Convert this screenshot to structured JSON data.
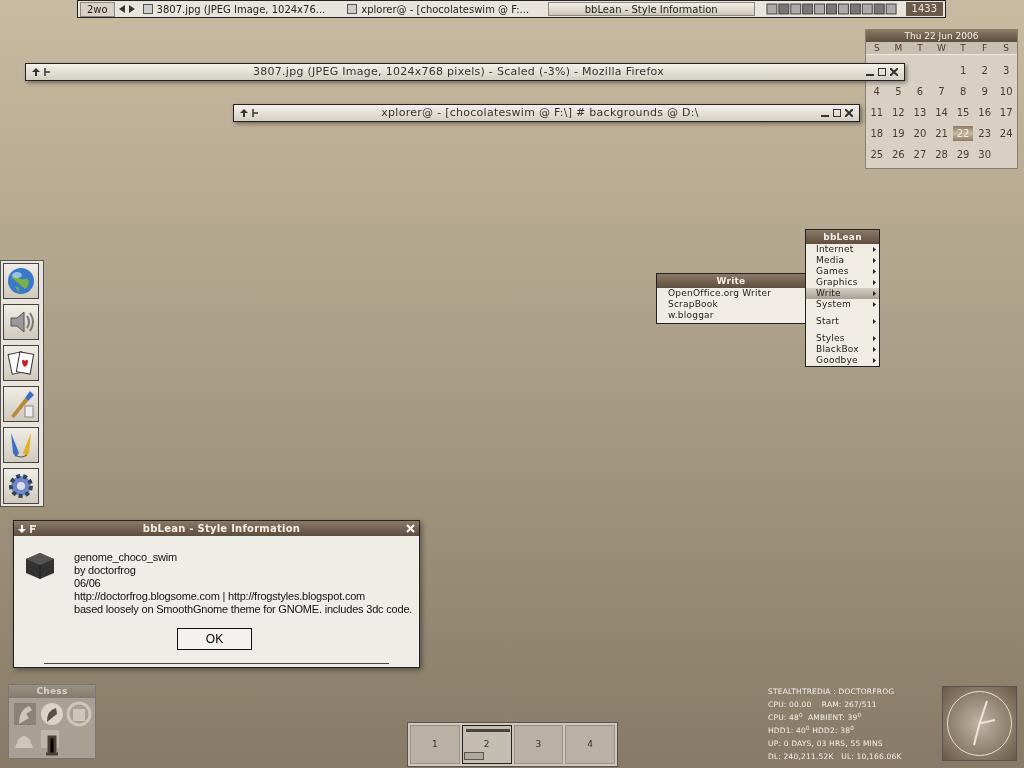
{
  "taskbar": {
    "workspace": "2wo",
    "tasks": [
      {
        "title": "3807.jpg (JPEG Image, 1024x76...",
        "selected": false
      },
      {
        "title": "xplorer@ - [chocolateswim @ F:...",
        "selected": false
      },
      {
        "title": "bbLean - Style Information",
        "selected": true
      }
    ],
    "clock": "1433"
  },
  "windows": [
    {
      "title": "3807.jpg (JPEG Image, 1024x768 pixels) - Scaled (-3%) - Mozilla Firefox"
    },
    {
      "title": "xplorer@ - [chocolateswim @ F:\\] # backgrounds @ D:\\"
    }
  ],
  "calendar": {
    "title": "Thu 22 Jun 2006",
    "weekdays": [
      "S",
      "M",
      "T",
      "W",
      "T",
      "F",
      "S"
    ],
    "weeks": [
      [
        {
          "label": "1",
          "selected": false
        },
        {
          "label": "2",
          "selected": false
        },
        {
          "label": "3",
          "selected": false
        }
      ],
      [
        {
          "label": "4",
          "selected": false
        },
        {
          "label": "5",
          "selected": false
        },
        {
          "label": "6",
          "selected": false
        },
        {
          "label": "7",
          "selected": false
        },
        {
          "label": "8",
          "selected": false
        },
        {
          "label": "9",
          "selected": false
        },
        {
          "label": "10",
          "selected": false
        }
      ],
      [
        {
          "label": "11",
          "selected": false
        },
        {
          "label": "12",
          "selected": false
        },
        {
          "label": "13",
          "selected": false
        },
        {
          "label": "14",
          "selected": false
        },
        {
          "label": "15",
          "selected": false
        },
        {
          "label": "16",
          "selected": false
        },
        {
          "label": "17",
          "selected": false
        }
      ],
      [
        {
          "label": "18",
          "selected": false
        },
        {
          "label": "19",
          "selected": false
        },
        {
          "label": "20",
          "selected": false
        },
        {
          "label": "21",
          "selected": false
        },
        {
          "label": "22",
          "selected": true
        },
        {
          "label": "23",
          "selected": false
        },
        {
          "label": "24",
          "selected": false
        }
      ],
      [
        {
          "label": "25",
          "selected": false
        },
        {
          "label": "26",
          "selected": false
        },
        {
          "label": "27",
          "selected": false
        },
        {
          "label": "28",
          "selected": false
        },
        {
          "label": "29",
          "selected": false
        },
        {
          "label": "30",
          "selected": false
        }
      ]
    ]
  },
  "main_menu": {
    "title": "bbLean",
    "groups": [
      [
        {
          "label": "Internet",
          "selected": false
        },
        {
          "label": "Media",
          "selected": false
        },
        {
          "label": "Games",
          "selected": false
        },
        {
          "label": "Graphics",
          "selected": false
        },
        {
          "label": "Write",
          "selected": true
        },
        {
          "label": "System",
          "selected": false
        }
      ],
      [
        {
          "label": "Start",
          "selected": false
        }
      ],
      [
        {
          "label": "Styles",
          "selected": false
        },
        {
          "label": "BlackBox",
          "selected": false
        },
        {
          "label": "Goodbye",
          "selected": false
        }
      ]
    ]
  },
  "submenu": {
    "title": "Write",
    "items": [
      "OpenOffice.org Writer",
      "ScrapBook",
      "w.bloggar"
    ]
  },
  "dock": {
    "items": [
      {
        "kind": "globe"
      },
      {
        "kind": "speaker"
      },
      {
        "kind": "cards"
      },
      {
        "kind": "brush"
      },
      {
        "kind": "pencil"
      },
      {
        "kind": "gear"
      }
    ]
  },
  "dialog": {
    "title": "bbLean - Style Information",
    "lines": [
      "genome_choco_swim",
      "by doctorfrog",
      "06/06",
      "http://doctorfrog.blogsome.com | http://frogstyles.blogspot.com",
      "based loosely on SmoothGnome theme for GNOME. includes 3dc code."
    ],
    "button": "OK"
  },
  "chess": {
    "title": "Chess"
  },
  "pager": {
    "desktops": [
      {
        "label": "1",
        "selected": false
      },
      {
        "label": "2",
        "selected": true
      },
      {
        "label": "3",
        "selected": false
      },
      {
        "label": "4",
        "selected": false
      }
    ]
  },
  "stats": {
    "lines": [
      "STEALTHTREDIA : DOCTORFROG",
      "CPU: 00.00    RAM: 267/511",
      "CPU: 48$^{0}$  AMBIENT: 39$^{0}$",
      "HDD1: 40$^{0}$ HDD2: 38$^{0}$",
      "UP: 0 DAYS, 03 HRS, 55 MINS",
      "DL: 240,211.52K   UL: 10,166.06K"
    ]
  }
}
